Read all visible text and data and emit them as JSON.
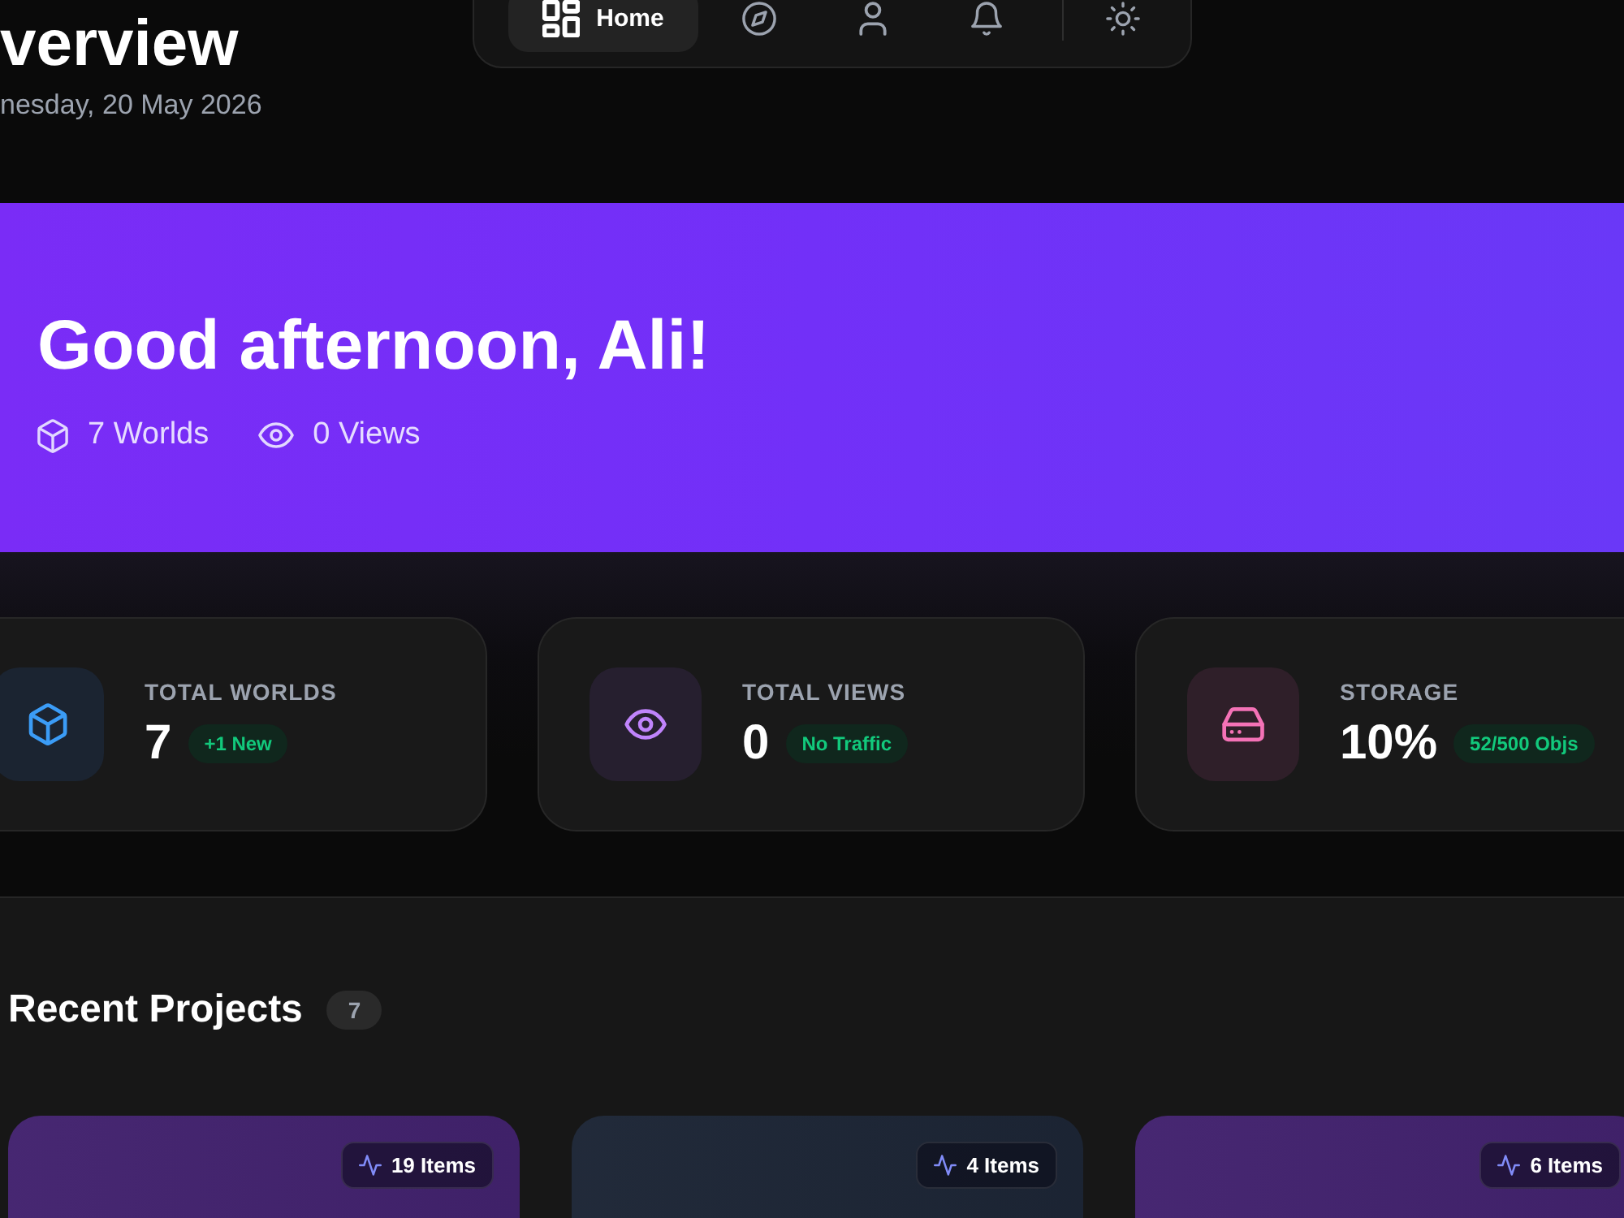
{
  "header": {
    "title": "verview",
    "date": "nesday, 20 May 2026"
  },
  "nav": {
    "items": [
      {
        "kind": "home",
        "label": "Home",
        "selected": true
      },
      {
        "kind": "explore",
        "selected": false
      },
      {
        "kind": "profile",
        "selected": false
      },
      {
        "kind": "notifications",
        "selected": false
      },
      {
        "kind": "theme",
        "selected": false
      }
    ]
  },
  "hero": {
    "greeting": "Good afternoon, Ali!",
    "stats": [
      {
        "kind": "worlds",
        "text": "7 Worlds"
      },
      {
        "kind": "views",
        "text": "0 Views"
      }
    ]
  },
  "stat_cards": [
    {
      "kind": "worlds",
      "label": "TOTAL WORLDS",
      "value": "7",
      "note": "+1 New"
    },
    {
      "kind": "views",
      "label": "TOTAL VIEWS",
      "value": "0",
      "note": "No Traffic"
    },
    {
      "kind": "storage",
      "label": "STORAGE",
      "value": "10%",
      "note": "52/500 Objs"
    }
  ],
  "recent_projects": {
    "title": "Recent Projects",
    "count": "7",
    "projects": [
      {
        "items": "19 Items",
        "color": "#43236f"
      },
      {
        "items": "4 Items",
        "color": "#1d2636"
      },
      {
        "items": "6 Items",
        "color": "#43236f"
      }
    ]
  }
}
